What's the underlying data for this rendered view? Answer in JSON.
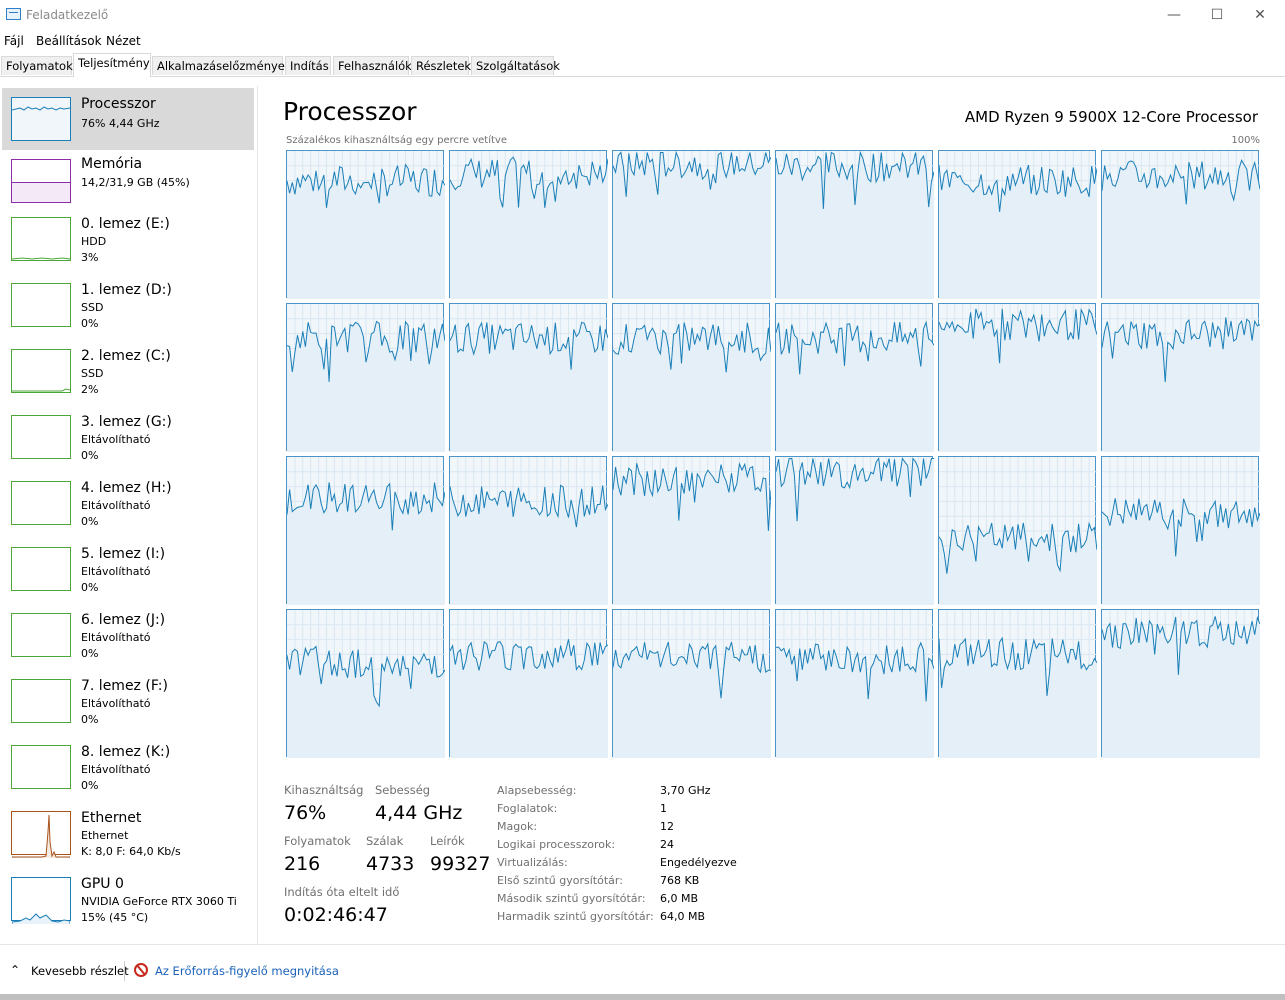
{
  "window": {
    "title": "Feladatkezelő"
  },
  "menu": [
    "Fájl",
    "Beállítások",
    "Nézet"
  ],
  "tabs": [
    "Folyamatok",
    "Teljesítmény",
    "Alkalmazáselőzmények",
    "Indítás",
    "Felhasználók",
    "Részletek",
    "Szolgáltatások"
  ],
  "active_tab": "Teljesítmény",
  "sidebar": [
    {
      "title": "Processzor",
      "lines": [
        "76% 4,44 GHz"
      ],
      "selected": true
    },
    {
      "title": "Memória",
      "lines": [
        "14,2/31,9 GB (45%)"
      ]
    },
    {
      "title": "0. lemez (E:)",
      "lines": [
        "HDD",
        "3%"
      ]
    },
    {
      "title": "1. lemez (D:)",
      "lines": [
        "SSD",
        "0%"
      ]
    },
    {
      "title": "2. lemez (C:)",
      "lines": [
        "SSD",
        "2%"
      ]
    },
    {
      "title": "3. lemez (G:)",
      "lines": [
        "Eltávolítható",
        "0%"
      ]
    },
    {
      "title": "4. lemez (H:)",
      "lines": [
        "Eltávolítható",
        "0%"
      ]
    },
    {
      "title": "5. lemez (I:)",
      "lines": [
        "Eltávolítható",
        "0%"
      ]
    },
    {
      "title": "6. lemez (J:)",
      "lines": [
        "Eltávolítható",
        "0%"
      ]
    },
    {
      "title": "7. lemez (F:)",
      "lines": [
        "Eltávolítható",
        "0%"
      ]
    },
    {
      "title": "8. lemez (K:)",
      "lines": [
        "Eltávolítható",
        "0%"
      ]
    },
    {
      "title": "Ethernet",
      "lines": [
        "Ethernet",
        "K: 8,0  F: 64,0 Kb/s"
      ]
    },
    {
      "title": "GPU 0",
      "lines": [
        "NVIDIA GeForce RTX 3060 Ti",
        "15% (45 °C)"
      ]
    }
  ],
  "main": {
    "title": "Processzor",
    "cpu_name": "AMD Ryzen 9 5900X 12-Core Processor",
    "graph_label": "Százalékos kihasználtság egy percre vetítve",
    "graph_max": "100%"
  },
  "chart_data": {
    "type": "line",
    "title": "",
    "xlabel": "",
    "ylabel": "",
    "ylim": [
      0,
      100
    ],
    "grid": true,
    "core_count": 24,
    "approx_core_levels": [
      80,
      85,
      92,
      90,
      80,
      83,
      78,
      77,
      77,
      77,
      86,
      80,
      72,
      70,
      85,
      90,
      45,
      62,
      65,
      70,
      68,
      68,
      70,
      85
    ]
  },
  "stats": {
    "utilization_label": "Kihasználtság",
    "utilization": "76%",
    "speed_label": "Sebesség",
    "speed": "4,44 GHz",
    "processes_label": "Folyamatok",
    "processes": "216",
    "threads_label": "Szálak",
    "threads": "4733",
    "handles_label": "Leírók",
    "handles": "99327",
    "uptime_label": "Indítás óta eltelt idő",
    "uptime": "0:02:46:47"
  },
  "specs": [
    {
      "label": "Alapsebesség:",
      "value": "3,70 GHz"
    },
    {
      "label": "Foglalatok:",
      "value": "1"
    },
    {
      "label": "Magok:",
      "value": "12"
    },
    {
      "label": "Logikai processzorok:",
      "value": "24"
    },
    {
      "label": "Virtualizálás:",
      "value": "Engedélyezve"
    },
    {
      "label": "Első szintű gyorsítótár:",
      "value": "768 KB"
    },
    {
      "label": "Második szintű gyorsítótár:",
      "value": "6,0 MB"
    },
    {
      "label": "Harmadik szintű gyorsítótár:",
      "value": "64,0 MB"
    }
  ],
  "footer": {
    "fewer": "Kevesebb részlet",
    "resmon": "Az Erőforrás-figyelő megnyitása"
  },
  "colors": {
    "cpu": "#1a7fb8",
    "memory": "#8b2ea8",
    "disk": "#4ca63a",
    "ethernet": "#a7521a",
    "gpu": "#1a7fb8"
  }
}
